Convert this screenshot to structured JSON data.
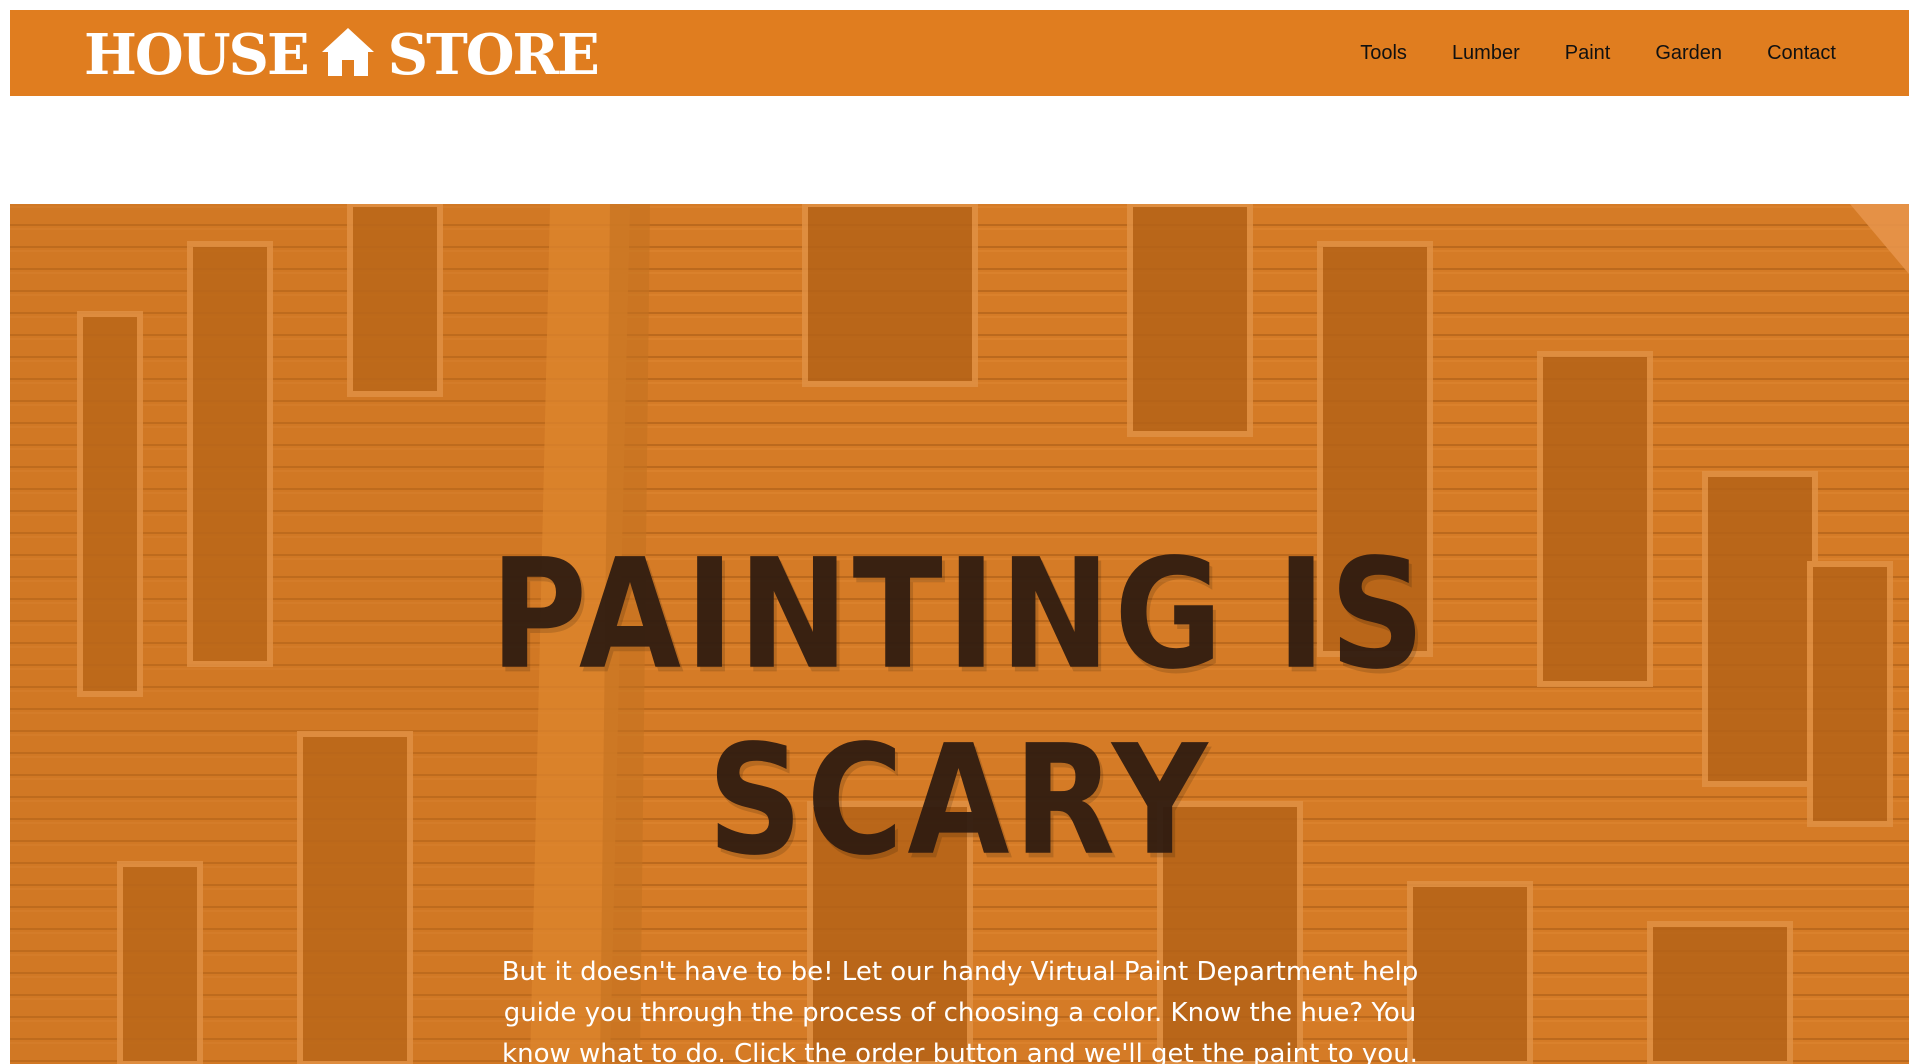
{
  "brand": {
    "logo_left": "HOUSE",
    "logo_right": "STORE",
    "logo_icon": "house-icon",
    "color": "#e07d1f"
  },
  "nav": {
    "items": [
      {
        "label": "Tools"
      },
      {
        "label": "Lumber"
      },
      {
        "label": "Paint"
      },
      {
        "label": "Garden"
      },
      {
        "label": "Contact"
      }
    ]
  },
  "hero": {
    "title_line1": "PAINTING IS",
    "title_line2": "SCARY",
    "body": "But it doesn't have to be! Let our handy Virtual Paint Department help guide you through the process of choosing a color. Know the hue? You know what to do. Click the order button and we'll get the paint to you.",
    "overlay_color": "#e07d1f",
    "title_color": "#2c1a10"
  }
}
